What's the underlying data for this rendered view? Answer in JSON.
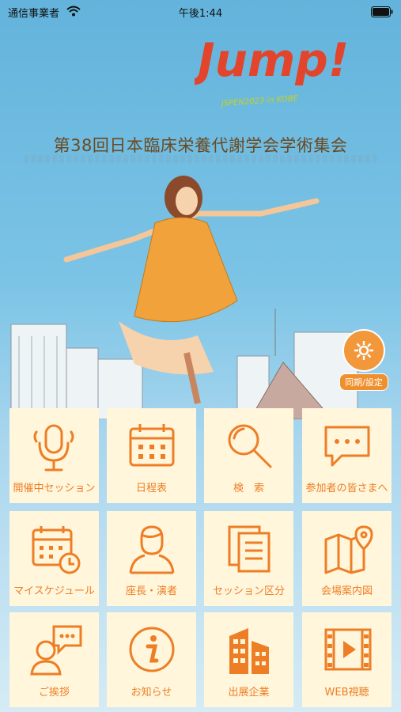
{
  "status_bar": {
    "carrier": "通信事業者",
    "time": "午後1:44"
  },
  "logo": {
    "main": "Jump!",
    "sub": "JSPEN2023 in KOBE"
  },
  "conference_title": "第38回日本臨床栄養代謝学会学術集会",
  "sync_button": {
    "label": "同期/設定",
    "icon": "gear-icon"
  },
  "colors": {
    "accent": "#ee7e25",
    "tile_bg": "#fff6dc",
    "title": "#6b4a22"
  },
  "menu": [
    {
      "label": "開催中セッション",
      "icon": "microphone-icon"
    },
    {
      "label": "日程表",
      "icon": "calendar-icon"
    },
    {
      "label": "検　索",
      "icon": "search-icon"
    },
    {
      "label": "参加者の皆さまへ",
      "icon": "chat-bubble-icon"
    },
    {
      "label": "マイスケジュール",
      "icon": "calendar-clock-icon"
    },
    {
      "label": "座長・演者",
      "icon": "person-icon"
    },
    {
      "label": "セッション区分",
      "icon": "documents-icon"
    },
    {
      "label": "会場案内図",
      "icon": "map-pin-icon"
    },
    {
      "label": "ご挨拶",
      "icon": "person-speech-icon"
    },
    {
      "label": "お知らせ",
      "icon": "info-icon"
    },
    {
      "label": "出展企業",
      "icon": "building-icon"
    },
    {
      "label": "WEB視聴",
      "icon": "video-icon"
    }
  ]
}
